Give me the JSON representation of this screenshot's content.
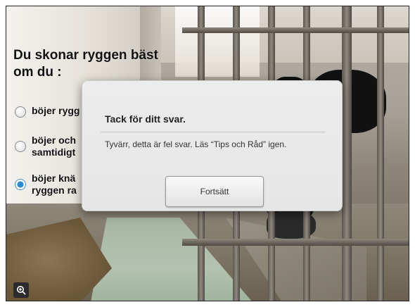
{
  "question": {
    "line1": "Du skonar ryggen bäst",
    "line2": "om du :"
  },
  "options": [
    {
      "line1": "böjer rygg",
      "line2": "",
      "selected": false
    },
    {
      "line1": "böjer och",
      "line2": "samtidigt",
      "selected": false
    },
    {
      "line1": "böjer knä",
      "line2": "ryggen ra",
      "selected": true
    }
  ],
  "dialog": {
    "title": "Tack för ditt svar.",
    "message": "Tyvärr, detta är fel svar. Läs “Tips och Råd” igen.",
    "continue_label": "Fortsätt"
  },
  "zoom_icon": "zoom-in-icon",
  "colors": {
    "selected_radio": "#2e88cf",
    "zoom_button_bg": "#2b2b2b"
  }
}
